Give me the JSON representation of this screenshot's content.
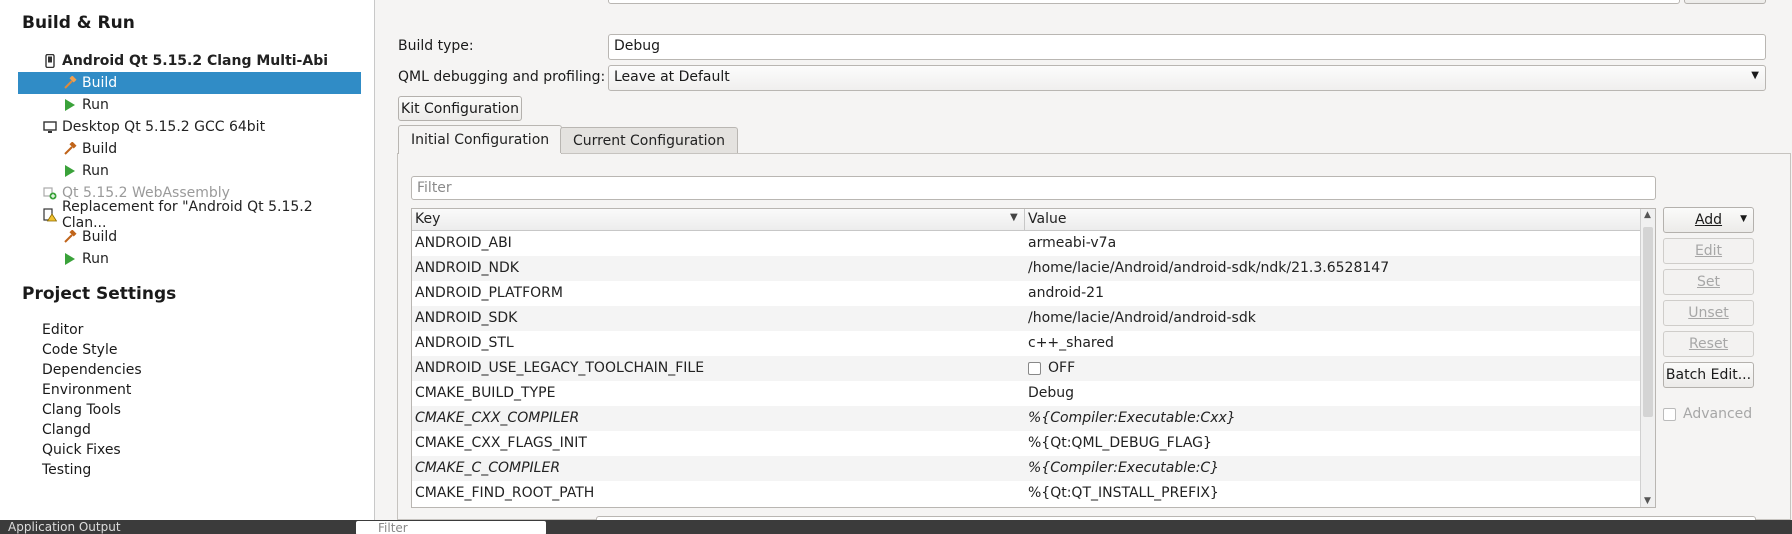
{
  "sidebar": {
    "build_run_title": "Build & Run",
    "tree": [
      {
        "label": "Android Qt 5.15.2 Clang Multi-Abi",
        "icon": "android-device-icon"
      },
      {
        "label": "Build",
        "icon": "hammer-icon"
      },
      {
        "label": "Run",
        "icon": "run-triangle-icon"
      },
      {
        "label": "Desktop Qt 5.15.2 GCC 64bit",
        "icon": "desktop-monitor-icon"
      },
      {
        "label": "Build",
        "icon": "hammer-icon"
      },
      {
        "label": "Run",
        "icon": "run-triangle-icon"
      },
      {
        "label": "Qt 5.15.2 WebAssembly",
        "icon": "add-kit-icon"
      },
      {
        "label": "Replacement for \"Android Qt 5.15.2 Clan...",
        "icon": "warning-kit-icon"
      },
      {
        "label": "Build",
        "icon": "hammer-icon"
      },
      {
        "label": "Run",
        "icon": "run-triangle-icon"
      }
    ],
    "project_settings_title": "Project Settings",
    "settings": [
      "Editor",
      "Code Style",
      "Dependencies",
      "Environment",
      "Clang Tools",
      "Clangd",
      "Quick Fixes",
      "Testing"
    ]
  },
  "main": {
    "build_type_label": "Build type:",
    "build_type_value": "Debug",
    "qml_label": "QML debugging and profiling:",
    "qml_value": "Leave at Default",
    "kit_config_button": "Kit Configuration",
    "tabs": [
      {
        "label": "Initial Configuration"
      },
      {
        "label": "Current Configuration"
      }
    ],
    "filter_placeholder": "Filter",
    "table": {
      "col_key": "Key",
      "col_value": "Value",
      "rows": [
        {
          "key": "ANDROID_ABI",
          "value": "armeabi-v7a"
        },
        {
          "key": "ANDROID_NDK",
          "value": "/home/lacie/Android/android-sdk/ndk/21.3.6528147"
        },
        {
          "key": "ANDROID_PLATFORM",
          "value": "android-21"
        },
        {
          "key": "ANDROID_SDK",
          "value": "/home/lacie/Android/android-sdk"
        },
        {
          "key": "ANDROID_STL",
          "value": "c++_shared"
        },
        {
          "key": "ANDROID_USE_LEGACY_TOOLCHAIN_FILE",
          "value": "OFF",
          "checkbox": true
        },
        {
          "key": "CMAKE_BUILD_TYPE",
          "value": "Debug"
        },
        {
          "key": "CMAKE_CXX_COMPILER",
          "value": "%{Compiler:Executable:Cxx}",
          "italic": true
        },
        {
          "key": "CMAKE_CXX_FLAGS_INIT",
          "value": "%{Qt:QML_DEBUG_FLAG}"
        },
        {
          "key": "CMAKE_C_COMPILER",
          "value": "%{Compiler:Executable:C}",
          "italic": true
        },
        {
          "key": "CMAKE_FIND_ROOT_PATH",
          "value": "%{Qt:QT_INSTALL_PREFIX}"
        }
      ]
    },
    "side_buttons": {
      "add": "Add",
      "edit": "Edit",
      "set": "Set",
      "unset": "Unset",
      "reset": "Reset",
      "batch_edit": "Batch Edit...",
      "advanced": "Advanced"
    }
  },
  "bottombar": {
    "output_tab": "Application Output",
    "filter_placeholder": "Filter"
  },
  "colors": {
    "selection": "#308cc6",
    "run_green": "#3aa23a",
    "accent_orange": "#c0641a"
  }
}
